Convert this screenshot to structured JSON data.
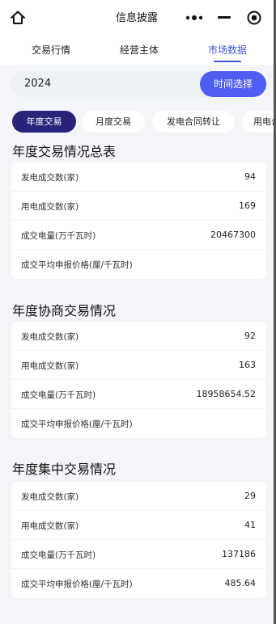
{
  "header": {
    "title": "信息披露"
  },
  "tabs": [
    {
      "label": "交易行情"
    },
    {
      "label": "经营主体"
    },
    {
      "label": "市场数据"
    }
  ],
  "year_filter": {
    "value": "2024",
    "button_label": "时间选择"
  },
  "chips": [
    {
      "label": "年度交易"
    },
    {
      "label": "月度交易"
    },
    {
      "label": "发电合同转让"
    },
    {
      "label": "用电合"
    }
  ],
  "sections": [
    {
      "title": "年度交易情况总表",
      "rows": [
        {
          "label": "发电成交数(家)",
          "value": "94"
        },
        {
          "label": "用电成交数(家)",
          "value": "169"
        },
        {
          "label": "成交电量(万千瓦时)",
          "value": "20467300"
        },
        {
          "label": "成交平均申报价格(厘/千瓦时)",
          "value": ""
        }
      ]
    },
    {
      "title": "年度协商交易情况",
      "rows": [
        {
          "label": "发电成交数(家)",
          "value": "92"
        },
        {
          "label": "用电成交数(家)",
          "value": "163"
        },
        {
          "label": "成交电量(万千瓦时)",
          "value": "18958654.52"
        },
        {
          "label": "成交平均申报价格(厘/千瓦时)",
          "value": ""
        }
      ]
    },
    {
      "title": "年度集中交易情况",
      "rows": [
        {
          "label": "发电成交数(家)",
          "value": "29"
        },
        {
          "label": "用电成交数(家)",
          "value": "41"
        },
        {
          "label": "成交电量(万千瓦时)",
          "value": "137186"
        },
        {
          "label": "成交平均申报价格(厘/千瓦时)",
          "value": "485.64"
        }
      ]
    }
  ],
  "colors": {
    "accent": "#4d5ef0",
    "tab_active": "#3d56d6",
    "chip_active": "#27247a"
  }
}
